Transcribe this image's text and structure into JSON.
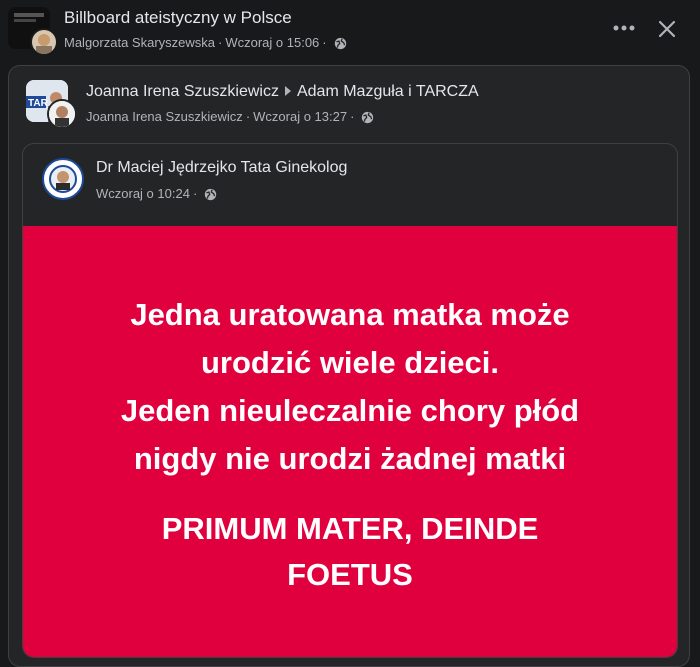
{
  "outer_post": {
    "group_name": "Billboard ateistyczny w Polsce",
    "author": "Malgorzata Skaryszewska",
    "time": "Wczoraj o 15:06",
    "more_label": "•••",
    "close_label": "✕"
  },
  "shared_post": {
    "author": "Joanna Irena Szuszkiewicz",
    "target": "Adam Mazguła i TARCZA",
    "sub_author": "Joanna Irena Szuszkiewicz",
    "time": "Wczoraj o 13:27",
    "avatar_text": "TAR"
  },
  "inner_post": {
    "author": "Dr Maciej Jędrzejko Tata Ginekolog",
    "time": "Wczoraj o 10:24",
    "poster": {
      "line1": "Jedna uratowana matka może",
      "line2": "urodzić wiele dzieci.",
      "line3": "Jeden nieuleczalnie chory płód",
      "line4": "nigdy nie urodzi żadnej matki",
      "line5": "PRIMUM MATER, DEINDE",
      "line6": "FOETUS",
      "background_color": "#e1003e"
    }
  },
  "icons": [
    "globe-icon",
    "more-options-icon",
    "close-icon",
    "arrow-right-icon"
  ]
}
